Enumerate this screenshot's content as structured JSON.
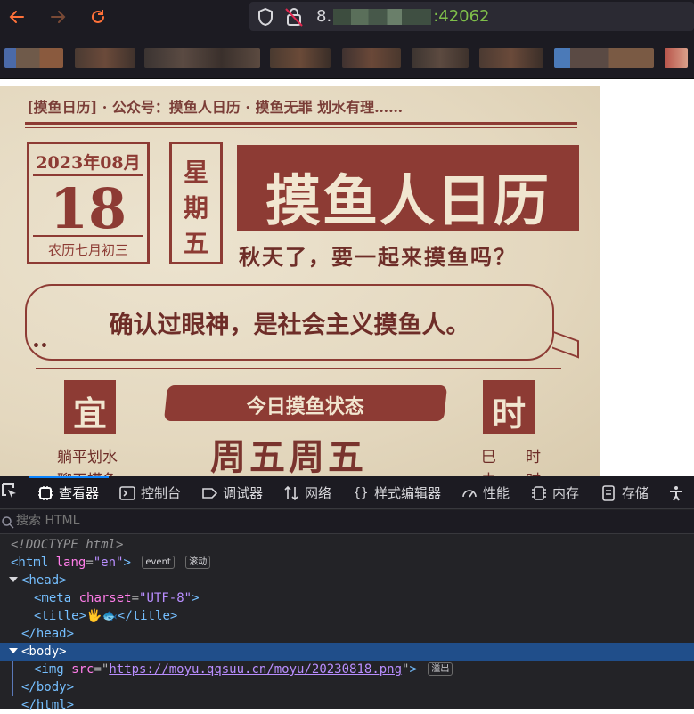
{
  "browser": {
    "url_prefix": "8.",
    "url_suffix": ":42062",
    "nav": {
      "back": "back-arrow-icon",
      "forward": "forward-arrow-icon",
      "reload": "reload-icon"
    }
  },
  "poster": {
    "top_bar": "[摸鱼日历]    ·    公众号：摸鱼人日历    ·    摸鱼无罪 划水有理……",
    "date_ym": "2023年08月",
    "date_day": "18",
    "date_lunar": "农历七月初三",
    "weekday": [
      "星",
      "期",
      "五"
    ],
    "title": "摸鱼人日历",
    "subtitle": "秋天了，要一起来摸鱼吗？",
    "quote": "确认过眼神，是社会主义摸鱼人。",
    "quote_dots": "••",
    "yi": "宜",
    "shi": "时",
    "status_label": "今日摸鱼状态",
    "status_value": "周五周五",
    "yi_items": [
      "躺平划水",
      "聊天摸鱼"
    ],
    "shi_items": [
      "巳",
      "未"
    ],
    "shi_items2": [
      "时",
      "时"
    ]
  },
  "devtools": {
    "tabs": [
      {
        "label": "查看器",
        "icon": "inspector-icon"
      },
      {
        "label": "控制台",
        "icon": "console-icon"
      },
      {
        "label": "调试器",
        "icon": "debugger-icon"
      },
      {
        "label": "网络",
        "icon": "network-icon"
      },
      {
        "label": "样式编辑器",
        "icon": "style-editor-icon"
      },
      {
        "label": "性能",
        "icon": "performance-icon"
      },
      {
        "label": "内存",
        "icon": "memory-icon"
      },
      {
        "label": "存储",
        "icon": "storage-icon"
      }
    ],
    "search_placeholder": "搜索 HTML",
    "dom": {
      "doctype": "<!DOCTYPE html>",
      "html_open": "<html",
      "lang_attr": "lang",
      "lang_val": "\"en\"",
      "html_close_bracket": ">",
      "badge_event": "event",
      "badge_scroll": "滚动",
      "head_open": "<head>",
      "meta_open": "<meta",
      "charset_attr": "charset",
      "charset_val": "\"UTF-8\"",
      "meta_close": ">",
      "title_open": "<title>",
      "title_text": "🖐🐟",
      "title_close": "</title>",
      "head_close": "</head>",
      "body_open": "<body>",
      "img_open": "<img",
      "src_attr": "src",
      "src_val": "https://moyu.qqsuu.cn/moyu/20230818.png",
      "img_close": ">",
      "badge_overflow": "溢出",
      "body_close": "</body>",
      "html_close": "</html>"
    }
  },
  "colors": {
    "poster_red": "#8d3b34",
    "paper": "#e4d8bf",
    "accent": "#0a84ff"
  }
}
